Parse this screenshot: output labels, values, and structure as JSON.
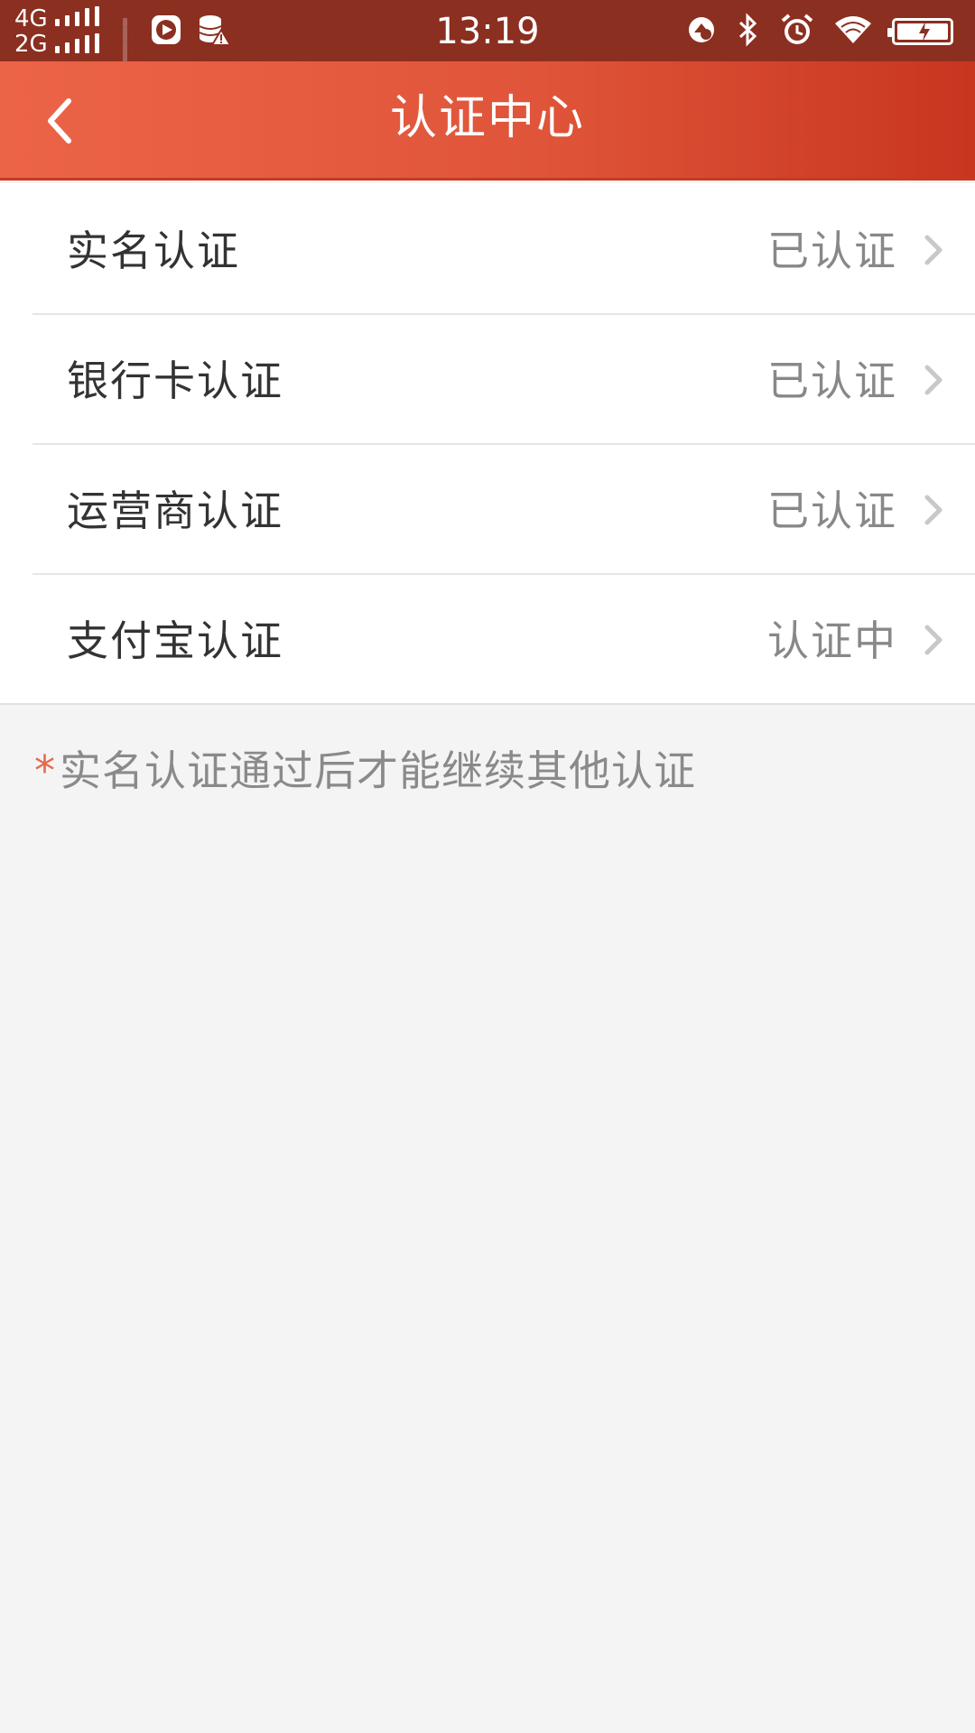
{
  "status_bar": {
    "network_top": "4G",
    "network_bottom": "2G",
    "time": "13:19"
  },
  "header": {
    "title": "认证中心"
  },
  "list": {
    "items": [
      {
        "label": "实名认证",
        "status": "已认证"
      },
      {
        "label": "银行卡认证",
        "status": "已认证"
      },
      {
        "label": "运营商认证",
        "status": "已认证"
      },
      {
        "label": "支付宝认证",
        "status": "认证中"
      }
    ]
  },
  "note": {
    "marker": "*",
    "text": "实名认证通过后才能继续其他认证"
  },
  "colors": {
    "header_start": "#ec6448",
    "header_end": "#c83520",
    "status_bar": "#8b2f21",
    "note_marker": "#e46a4e"
  },
  "icons": [
    "back-arrow-icon",
    "chevron-right-icon",
    "play-icon",
    "database-warning-icon",
    "rotation-lock-icon",
    "bluetooth-icon",
    "alarm-icon",
    "wifi-icon",
    "battery-charging-icon"
  ]
}
